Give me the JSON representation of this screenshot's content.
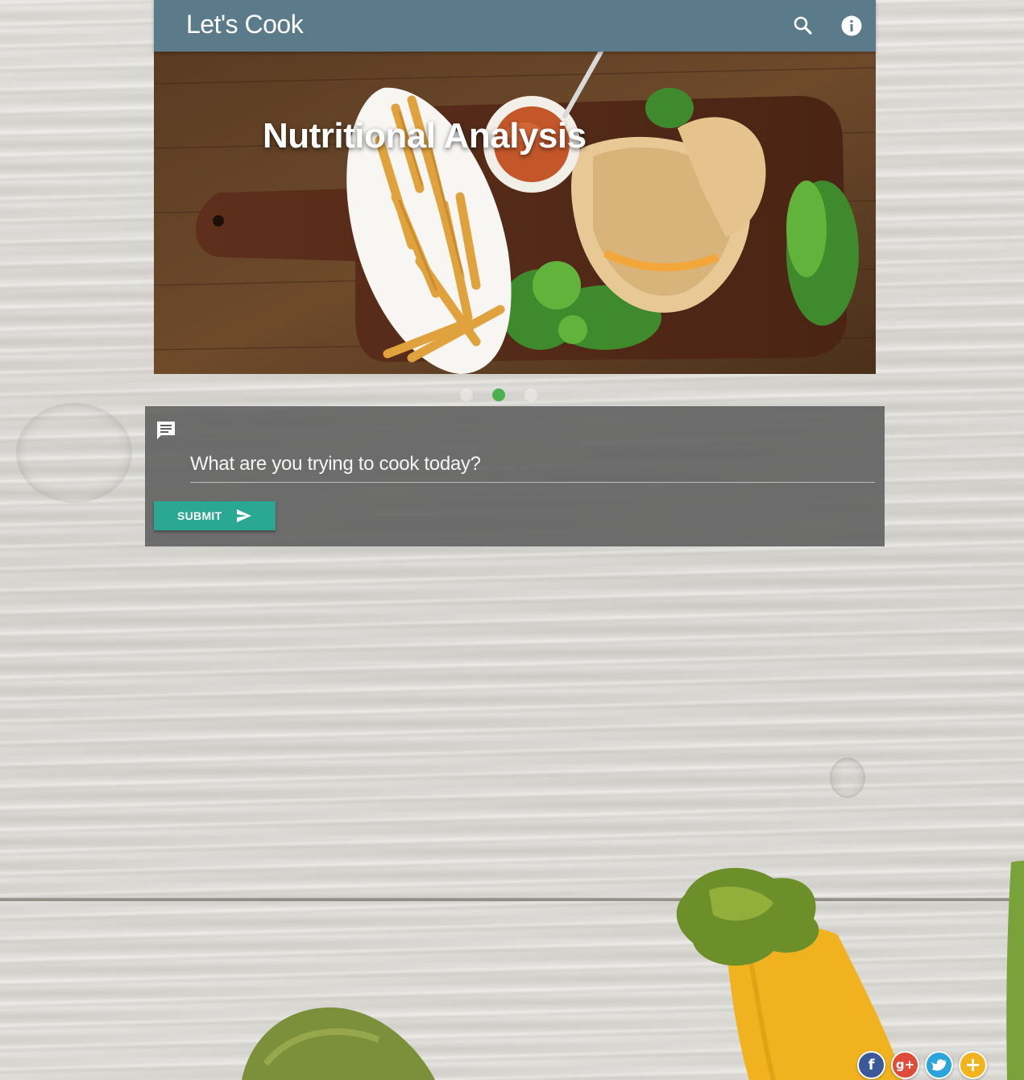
{
  "app_bar": {
    "title": "Let's Cook",
    "icons": [
      "search-icon",
      "info-icon"
    ],
    "color": "#5b7a8a"
  },
  "hero": {
    "title": "Nutritional Analysis"
  },
  "carousel": {
    "slide_count": 3,
    "active_index": 1,
    "active_color": "#4caf50"
  },
  "query": {
    "placeholder": "What are you trying to cook today?",
    "value": "",
    "submit_label": "SUBMIT",
    "submit_color": "#2aa894"
  },
  "social": {
    "facebook_glyph": "f",
    "google_plus_glyph": "g+",
    "add_glyph": "+",
    "colors": {
      "facebook": "#3b5998",
      "google_plus": "#dd4b39",
      "twitter": "#2ba4d9",
      "add": "#f2b31d"
    }
  }
}
